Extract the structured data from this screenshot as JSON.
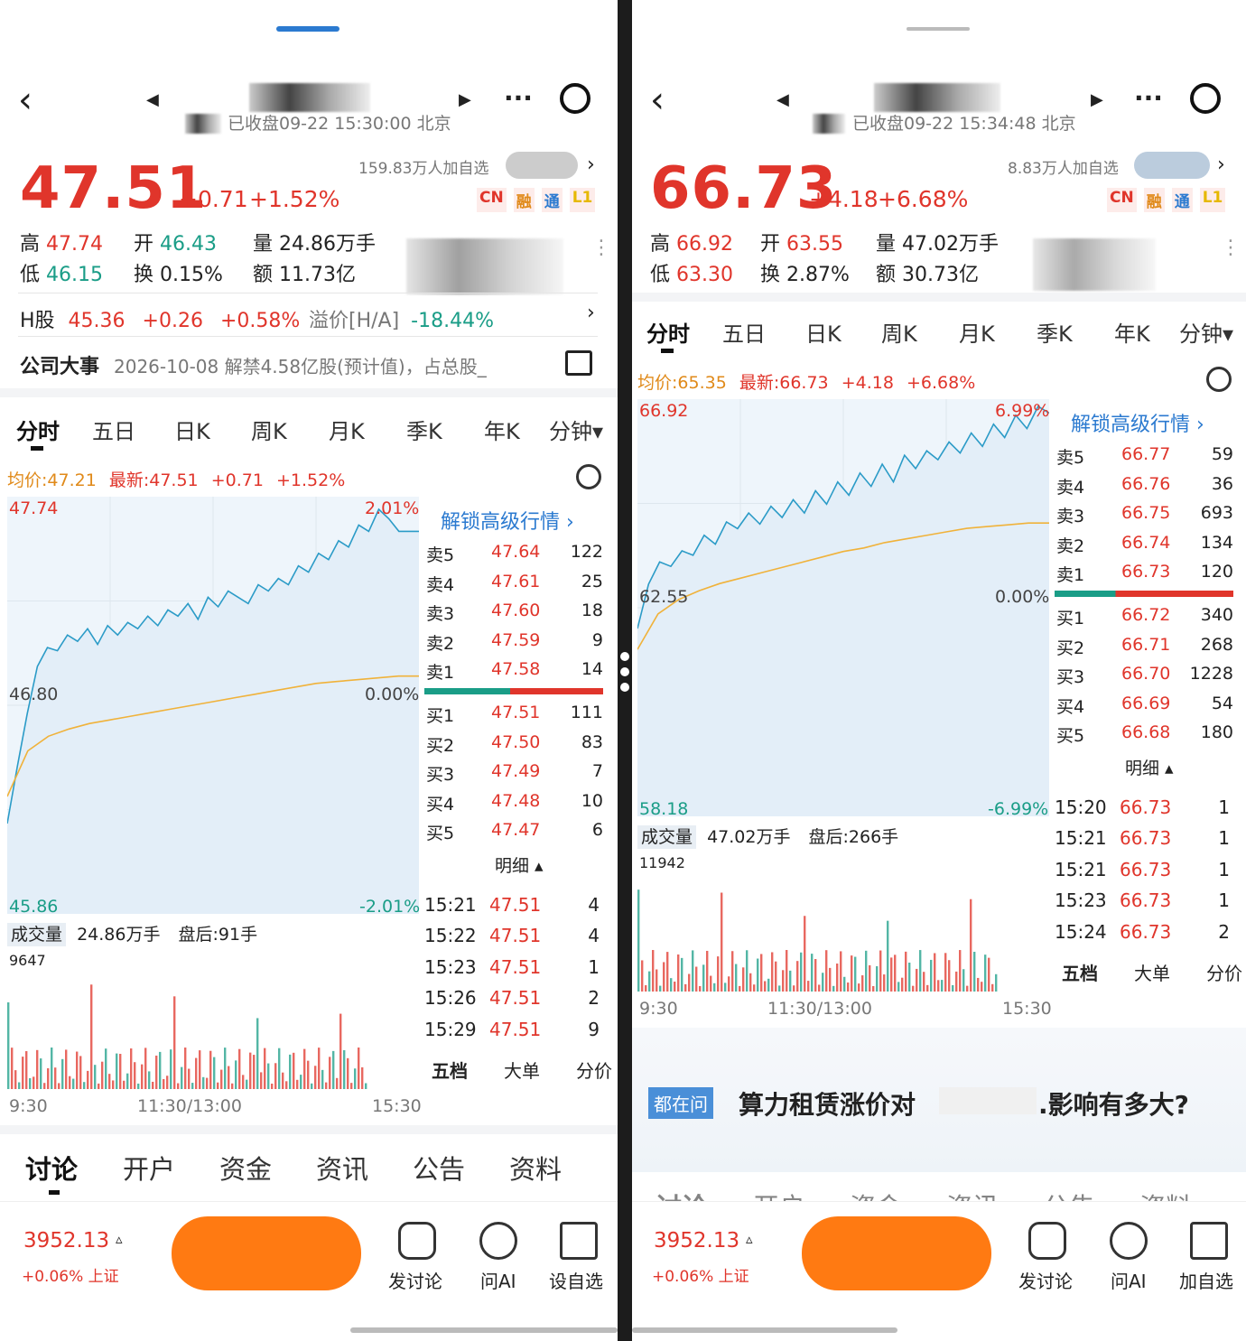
{
  "panels": [
    {
      "status": "已收盘09-22 15:30:00 北京",
      "followers": "159.83万人加自选",
      "price": "47.51",
      "change": "+0.71",
      "change_pct": "+1.52%",
      "badges": [
        "CN",
        "融",
        "通",
        "L1"
      ],
      "high_label": "高",
      "high": "47.74",
      "open_label": "开",
      "open": "46.43",
      "volume_label": "量",
      "volume": "24.86万手",
      "low_label": "低",
      "low": "46.15",
      "turnover_label": "换",
      "turnover": "0.15%",
      "amount_label": "额",
      "amount": "11.73亿",
      "hshare": {
        "label": "H股",
        "price": "45.36",
        "change": "+0.26",
        "pct": "+0.58%",
        "premium_label": "溢价[H/A]",
        "premium": "-18.44%"
      },
      "event": {
        "label": "公司大事",
        "text": "2026-10-08 解禁4.58亿股(预计值)，占总股_"
      },
      "tabs": [
        "分时",
        "五日",
        "日K",
        "周K",
        "月K",
        "季K",
        "年K",
        "分钟▾"
      ],
      "avg_line": {
        "avg": "均价:47.21",
        "latest": "最新:47.51",
        "chg": "+0.71",
        "pct": "+1.52%"
      },
      "axis": {
        "top": "47.74",
        "mid": "46.80",
        "bot": "45.86",
        "top_pct": "2.01%",
        "mid_pct": "0.00%",
        "bot_pct": "-2.01%"
      },
      "unlock": "解锁高级行情 ›",
      "asks": [
        [
          "卖5",
          "47.64",
          "122"
        ],
        [
          "卖4",
          "47.61",
          "25"
        ],
        [
          "卖3",
          "47.60",
          "18"
        ],
        [
          "卖2",
          "47.59",
          "9"
        ],
        [
          "卖1",
          "47.58",
          "14"
        ]
      ],
      "bids": [
        [
          "买1",
          "47.51",
          "111"
        ],
        [
          "买2",
          "47.50",
          "83"
        ],
        [
          "买3",
          "47.49",
          "7"
        ],
        [
          "买4",
          "47.48",
          "10"
        ],
        [
          "买5",
          "47.47",
          "6"
        ]
      ],
      "detail_label": "明细 ▴",
      "ticks": [
        [
          "15:21",
          "47.51",
          "4"
        ],
        [
          "15:22",
          "47.51",
          "4"
        ],
        [
          "15:23",
          "47.51",
          "1"
        ],
        [
          "15:26",
          "47.51",
          "2"
        ],
        [
          "15:29",
          "47.51",
          "9"
        ]
      ],
      "ob_tabs": [
        "五档",
        "大单",
        "分价"
      ],
      "vol_label": "成交量",
      "vol_total": "24.86万手",
      "vol_after": "盘后:91手",
      "vol_max": "9647",
      "times": [
        "9:30",
        "11:30/13:00",
        "15:30"
      ],
      "bottom_tabs": [
        "讨论",
        "开户",
        "资金",
        "资讯",
        "公告",
        "资料"
      ],
      "index": {
        "value": "3952.13",
        "arrow": "▵",
        "chg": "+0.06% 上证"
      },
      "actions": [
        "发讨论",
        "问AI",
        "设自选"
      ],
      "chart_series": [
        0.0,
        0.18,
        0.35,
        0.5,
        0.56,
        0.55,
        0.6,
        0.58,
        0.62,
        0.57,
        0.63,
        0.6,
        0.64,
        0.62,
        0.66,
        0.63,
        0.68,
        0.66,
        0.7,
        0.65,
        0.72,
        0.69,
        0.74,
        0.72,
        0.7,
        0.76,
        0.74,
        0.78,
        0.76,
        0.82,
        0.8,
        0.86,
        0.84,
        0.9,
        0.88,
        0.95,
        0.93,
        1.0,
        0.97,
        0.93,
        0.93,
        0.93
      ],
      "avg_series": [
        0.0,
        0.25,
        0.33,
        0.37,
        0.4,
        0.42,
        0.44,
        0.46,
        0.48,
        0.5,
        0.52,
        0.54,
        0.56,
        0.58,
        0.6,
        0.62,
        0.63,
        0.64,
        0.65,
        0.66,
        0.66
      ]
    },
    {
      "status": "已收盘09-22 15:34:48 北京",
      "followers": "8.83万人加自选",
      "price": "66.73",
      "change": "+4.18",
      "change_pct": "+6.68%",
      "badges": [
        "CN",
        "融",
        "通",
        "L1"
      ],
      "high_label": "高",
      "high": "66.92",
      "open_label": "开",
      "open": "63.55",
      "volume_label": "量",
      "volume": "47.02万手",
      "low_label": "低",
      "low": "63.30",
      "turnover_label": "换",
      "turnover": "2.87%",
      "amount_label": "额",
      "amount": "30.73亿",
      "tabs": [
        "分时",
        "五日",
        "日K",
        "周K",
        "月K",
        "季K",
        "年K",
        "分钟▾"
      ],
      "avg_line": {
        "avg": "均价:65.35",
        "latest": "最新:66.73",
        "chg": "+4.18",
        "pct": "+6.68%"
      },
      "axis": {
        "top": "66.92",
        "mid": "62.55",
        "bot": "58.18",
        "top_pct": "6.99%",
        "mid_pct": "0.00%",
        "bot_pct": "-6.99%"
      },
      "unlock": "解锁高级行情 ›",
      "asks": [
        [
          "卖5",
          "66.77",
          "59"
        ],
        [
          "卖4",
          "66.76",
          "36"
        ],
        [
          "卖3",
          "66.75",
          "693"
        ],
        [
          "卖2",
          "66.74",
          "134"
        ],
        [
          "卖1",
          "66.73",
          "120"
        ]
      ],
      "bids": [
        [
          "买1",
          "66.72",
          "340"
        ],
        [
          "买2",
          "66.71",
          "268"
        ],
        [
          "买3",
          "66.70",
          "1228"
        ],
        [
          "买4",
          "66.69",
          "54"
        ],
        [
          "买5",
          "66.68",
          "180"
        ]
      ],
      "detail_label": "明细 ▴",
      "ticks": [
        [
          "15:20",
          "66.73",
          "1"
        ],
        [
          "15:21",
          "66.73",
          "1"
        ],
        [
          "15:21",
          "66.73",
          "1"
        ],
        [
          "15:23",
          "66.73",
          "1"
        ],
        [
          "15:24",
          "66.73",
          "2"
        ]
      ],
      "ob_tabs": [
        "五档",
        "大单",
        "分价"
      ],
      "vol_label": "成交量",
      "vol_total": "47.02万手",
      "vol_after": "盘后:266手",
      "vol_max": "11942",
      "times": [
        "9:30",
        "11:30/13:00",
        "15:30"
      ],
      "question": {
        "tag": "都在问",
        "text_a": "算力租赁涨价对",
        "text_b": ".影响有多大?"
      },
      "bottom_tabs": [
        "讨论",
        "开户",
        "资金",
        "资讯",
        "公告",
        "资料"
      ],
      "index": {
        "value": "3952.13",
        "arrow": "▵",
        "chg": "+0.06% 上证"
      },
      "actions": [
        "发讨论",
        "问AI",
        "加自选"
      ],
      "chart_series": [
        0.0,
        0.2,
        0.3,
        0.28,
        0.35,
        0.33,
        0.42,
        0.38,
        0.48,
        0.45,
        0.52,
        0.47,
        0.55,
        0.5,
        0.58,
        0.52,
        0.62,
        0.56,
        0.66,
        0.6,
        0.7,
        0.64,
        0.74,
        0.66,
        0.78,
        0.72,
        0.8,
        0.76,
        0.84,
        0.79,
        0.88,
        0.82,
        0.92,
        0.86,
        0.96,
        0.9,
        1.0,
        0.97
      ],
      "avg_series": [
        0.0,
        0.2,
        0.28,
        0.33,
        0.37,
        0.4,
        0.43,
        0.46,
        0.49,
        0.52,
        0.55,
        0.57,
        0.6,
        0.62,
        0.64,
        0.66,
        0.68,
        0.69,
        0.7,
        0.71,
        0.71
      ]
    }
  ],
  "colors": {
    "up": "#e0352b",
    "down": "#1a9d87",
    "avg": "#f0b23a",
    "line": "#2b9bc7",
    "accent": "#ff7a12"
  }
}
